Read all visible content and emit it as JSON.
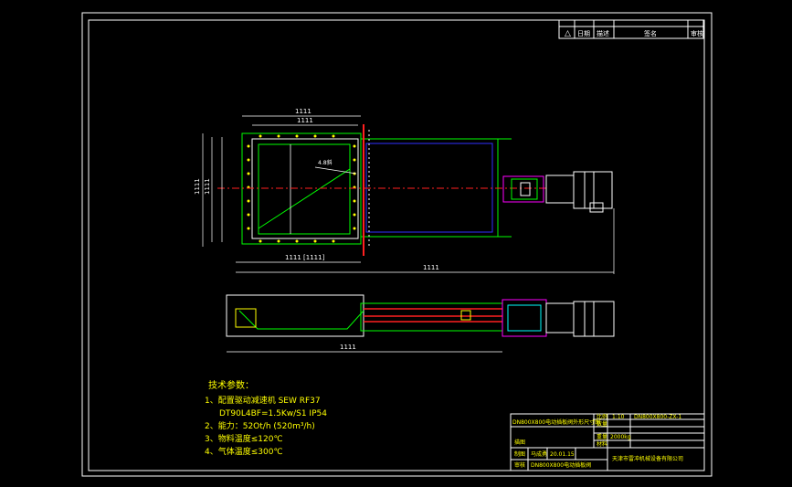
{
  "colors": {
    "frame": "#ffffff",
    "green": "#00ff00",
    "red": "#ff2020",
    "yellow": "#ffff00",
    "blue": "#3030ff",
    "cyan": "#00ffff",
    "magenta": "#ff00ff",
    "grey": "#c0c0c0"
  },
  "revision_table": {
    "headers": [
      "△",
      "日期",
      "描述",
      "签名",
      "审核"
    ]
  },
  "dimensions": {
    "top_width": "1111",
    "top_inner": "1111",
    "left_height": "1111",
    "left_height2": "1111",
    "bottom_inner": "1111 [1111]",
    "overall_length": "1111",
    "side_length": "1111",
    "angle_note": "4.8斜"
  },
  "technical_notes": {
    "title": "技术参数：",
    "line1": "1、配置驱动减速机 SEW RF37",
    "line2": "DT90L4BF=1.5Kw/S1  IP54",
    "line3": "2、能力：52Ot/h  (520m³/h)",
    "line4": "3、物料温度≤120℃",
    "line5": "4、气体温度≤300℃"
  },
  "title_block": {
    "drawing_name": "DN800X800电动插板阀外形尺寸图",
    "scale_label": "比例",
    "scale_value": "1:10",
    "drawing_no": "DN800X800-ZX-1",
    "qty_label": "数量",
    "weight_label": "重量",
    "weight_value": "2000kg",
    "material_label": "材料",
    "drawn_label": "制图",
    "drawn_by": "马成勇",
    "date_value": "20.01.15",
    "check_label": "描图",
    "approve_label": "审核",
    "product_name": "DN800X800电动插板阀",
    "company": "天津市雷冲机械设备有限公司"
  }
}
